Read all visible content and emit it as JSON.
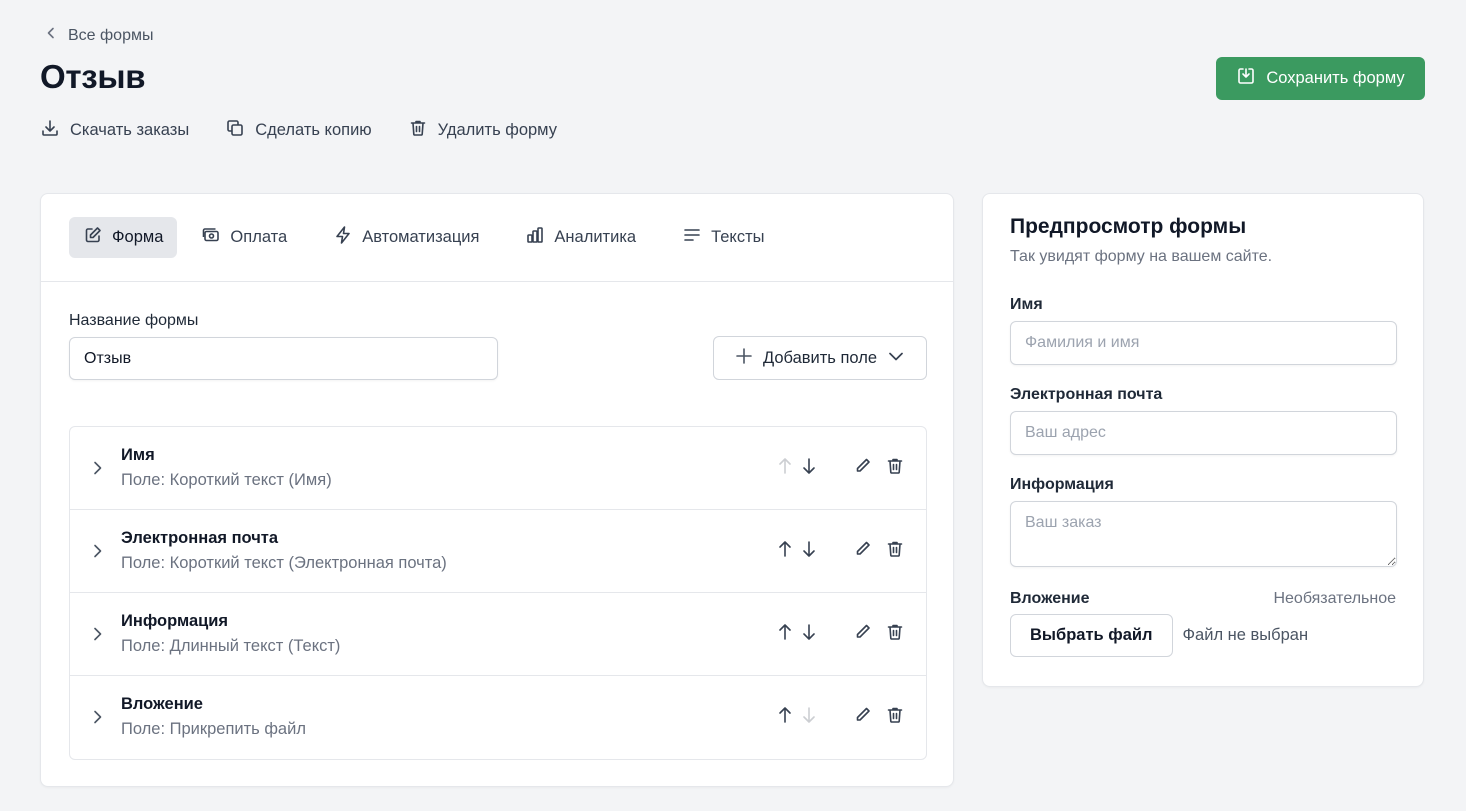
{
  "header": {
    "breadcrumb": "Все формы",
    "title": "Отзыв",
    "save_label": "Сохранить форму",
    "actions": [
      {
        "label": "Скачать заказы",
        "icon": "download-icon"
      },
      {
        "label": "Сделать копию",
        "icon": "copy-icon"
      },
      {
        "label": "Удалить форму",
        "icon": "trash-icon"
      }
    ]
  },
  "tabs": [
    {
      "label": "Форма",
      "icon": "edit-icon",
      "active": true
    },
    {
      "label": "Оплата",
      "icon": "payment-icon",
      "active": false
    },
    {
      "label": "Автоматизация",
      "icon": "lightning-icon",
      "active": false
    },
    {
      "label": "Аналитика",
      "icon": "chart-icon",
      "active": false
    },
    {
      "label": "Тексты",
      "icon": "text-lines-icon",
      "active": false
    }
  ],
  "form": {
    "name_label": "Название формы",
    "name_value": "Отзыв",
    "add_field_label": "Добавить поле"
  },
  "fields": [
    {
      "title": "Имя",
      "subtitle": "Поле: Короткий текст (Имя)",
      "up_enabled": false,
      "down_enabled": true
    },
    {
      "title": "Электронная почта",
      "subtitle": "Поле: Короткий текст (Электронная почта)",
      "up_enabled": true,
      "down_enabled": true
    },
    {
      "title": "Информация",
      "subtitle": "Поле: Длинный текст (Текст)",
      "up_enabled": true,
      "down_enabled": true
    },
    {
      "title": "Вложение",
      "subtitle": "Поле: Прикрепить файл",
      "up_enabled": true,
      "down_enabled": false
    }
  ],
  "preview": {
    "title": "Предпросмотр формы",
    "subtitle": "Так увидят форму на вашем сайте.",
    "name_label": "Имя",
    "name_placeholder": "Фамилия и имя",
    "email_label": "Электронная почта",
    "email_placeholder": "Ваш адрес",
    "info_label": "Информация",
    "info_placeholder": "Ваш заказ",
    "attach_label": "Вложение",
    "attach_optional": "Необязательное",
    "file_button": "Выбрать файл",
    "file_status": "Файл не выбран"
  },
  "colors": {
    "accent": "#3b9a60",
    "background": "#f3f4f6",
    "active_tab": "#e5e7eb"
  }
}
